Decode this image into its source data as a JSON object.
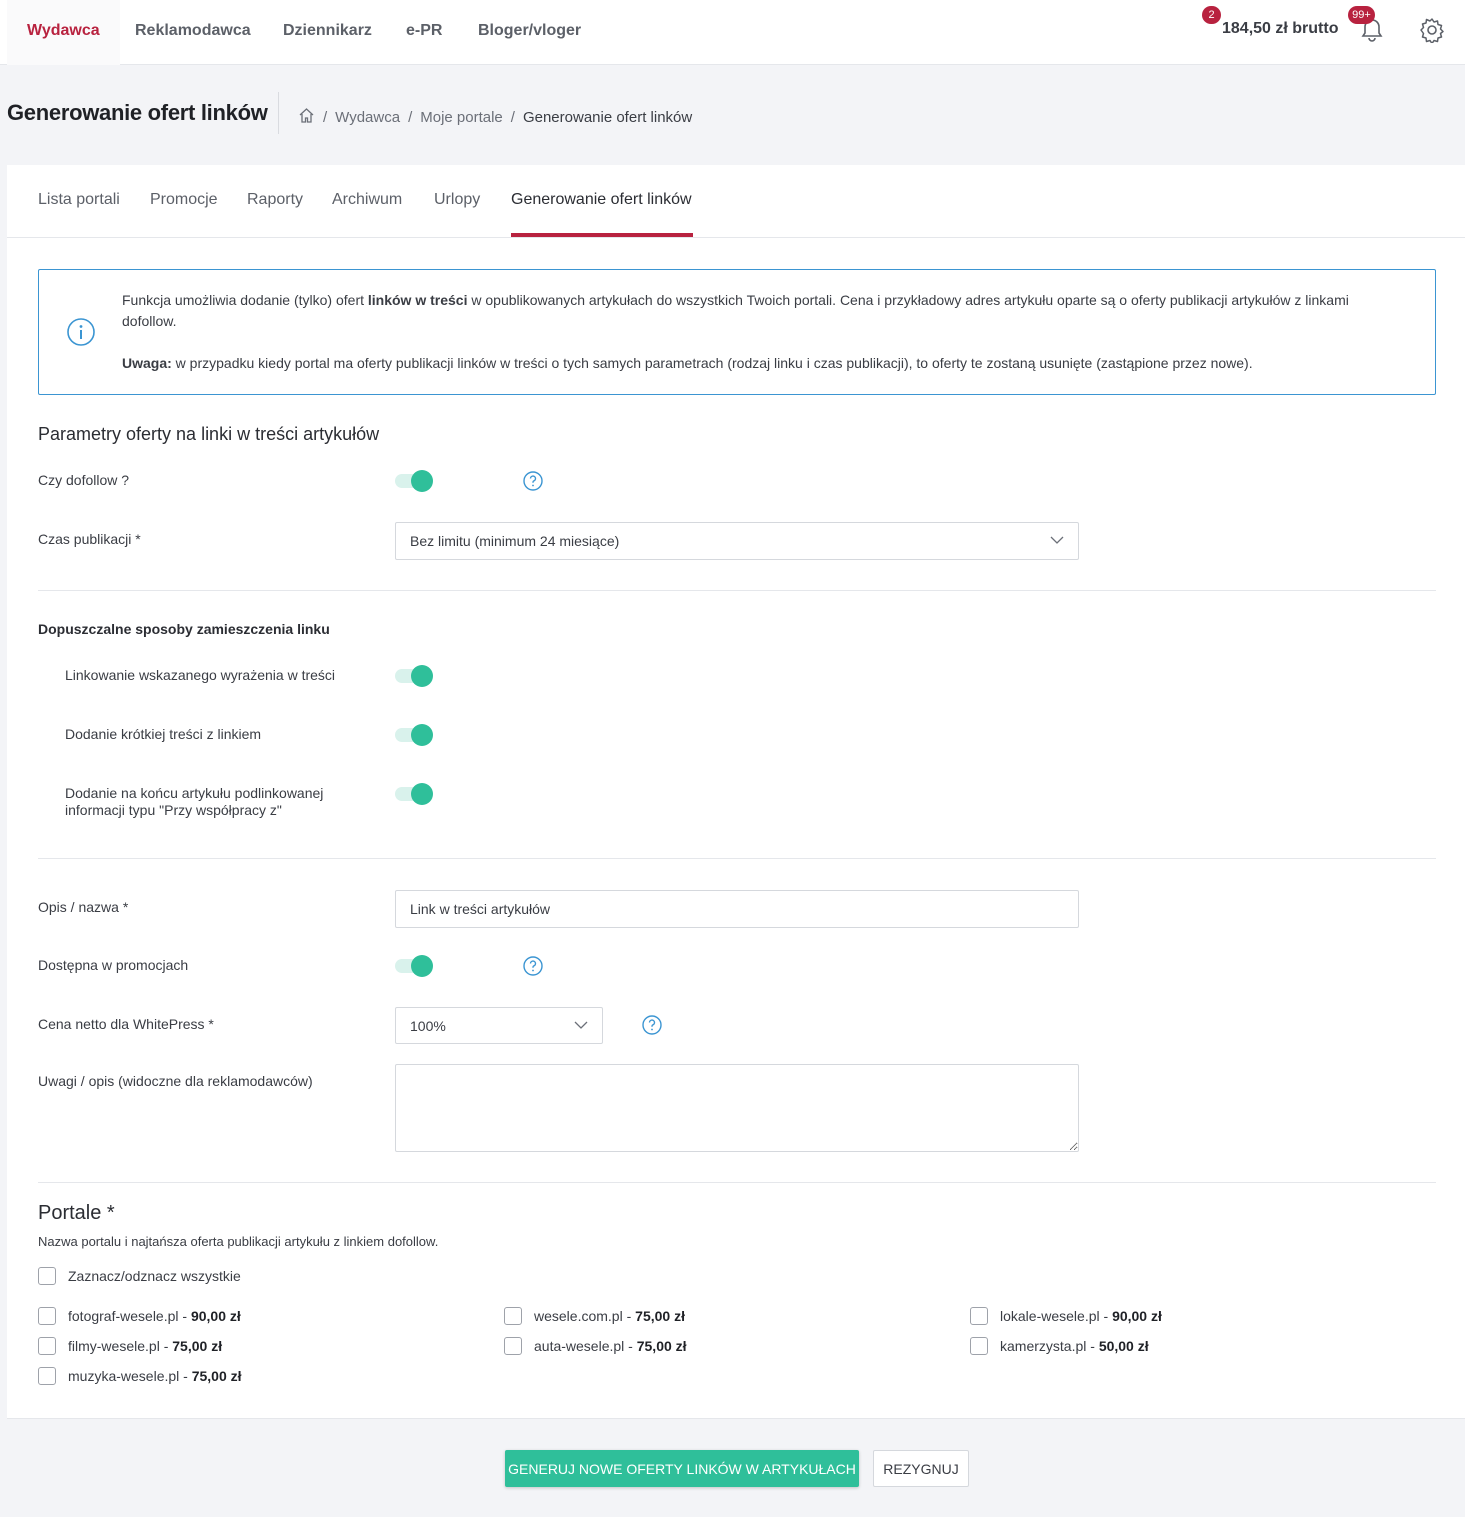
{
  "topnav": {
    "tabs": [
      "Wydawca",
      "Reklamodawca",
      "Dziennikarz",
      "e-PR",
      "Bloger/vloger"
    ],
    "cart_badge": "2",
    "balance": "184,50 zł brutto",
    "notifications_badge": "99+"
  },
  "page": {
    "title": "Generowanie ofert linków",
    "breadcrumb": [
      "Wydawca",
      "Moje portale",
      "Generowanie ofert linków"
    ]
  },
  "subtabs": [
    "Lista portali",
    "Promocje",
    "Raporty",
    "Archiwum",
    "Urlopy",
    "Generowanie ofert linków"
  ],
  "info": {
    "text_before": "Funkcja umożliwia dodanie (tylko) ofert ",
    "text_bold": "linków w treści",
    "text_after": " w opublikowanych artykułach do wszystkich Twoich portali. Cena i przykładowy adres artykułu oparte są o oferty publikacji artykułów z linkami dofollow.",
    "note_bold": "Uwaga:",
    "note_text": " w przypadku kiedy portal ma oferty publikacji linków w treści o tych samych parametrach (rodzaj linku i czas publikacji), to oferty te zostaną usunięte (zastąpione przez nowe)."
  },
  "form": {
    "section_title": "Parametry oferty na linki w treści artykułów",
    "dofollow_label": "Czy dofollow ?",
    "dofollow_on": true,
    "time_label": "Czas publikacji *",
    "time_value": "Bez limitu (minimum 24 miesiące)",
    "methods_title": "Dopuszczalne sposoby zamieszczenia linku",
    "method1": "Linkowanie wskazanego wyrażenia w treści",
    "method2": "Dodanie krótkiej treści z linkiem",
    "method3": "Dodanie na końcu artykułu podlinkowanej informacji typu \"Przy współpracy z\"",
    "name_label": "Opis / nazwa *",
    "name_value": "Link w treści artykułów",
    "promo_label": "Dostępna w promocjach",
    "price_label": "Cena netto dla WhitePress *",
    "price_value": "100%",
    "notes_label": "Uwagi / opis (widoczne dla reklamodawców)",
    "notes_value": ""
  },
  "portals": {
    "title": "Portale *",
    "subtitle": "Nazwa portalu i najtańsza oferta publikacji artykułu z linkiem dofollow.",
    "select_all": "Zaznacz/odznacz wszystkie",
    "items": [
      {
        "name": "fotograf-wesele.pl",
        "price": "90,00 zł"
      },
      {
        "name": "wesele.com.pl",
        "price": "75,00 zł"
      },
      {
        "name": "lokale-wesele.pl",
        "price": "90,00 zł"
      },
      {
        "name": "filmy-wesele.pl",
        "price": "75,00 zł"
      },
      {
        "name": "auta-wesele.pl",
        "price": "75,00 zł"
      },
      {
        "name": "kamerzysta.pl",
        "price": "50,00 zł"
      },
      {
        "name": "muzyka-wesele.pl",
        "price": "75,00 zł"
      }
    ]
  },
  "buttons": {
    "generate": "GENERUJ NOWE OFERTY LINKÓW W ARTYKUŁACH",
    "cancel": "REZYGNUJ"
  },
  "colors": {
    "accent": "#b8223f",
    "toggle": "#2fbf9a",
    "info_border": "#3b95d2"
  }
}
